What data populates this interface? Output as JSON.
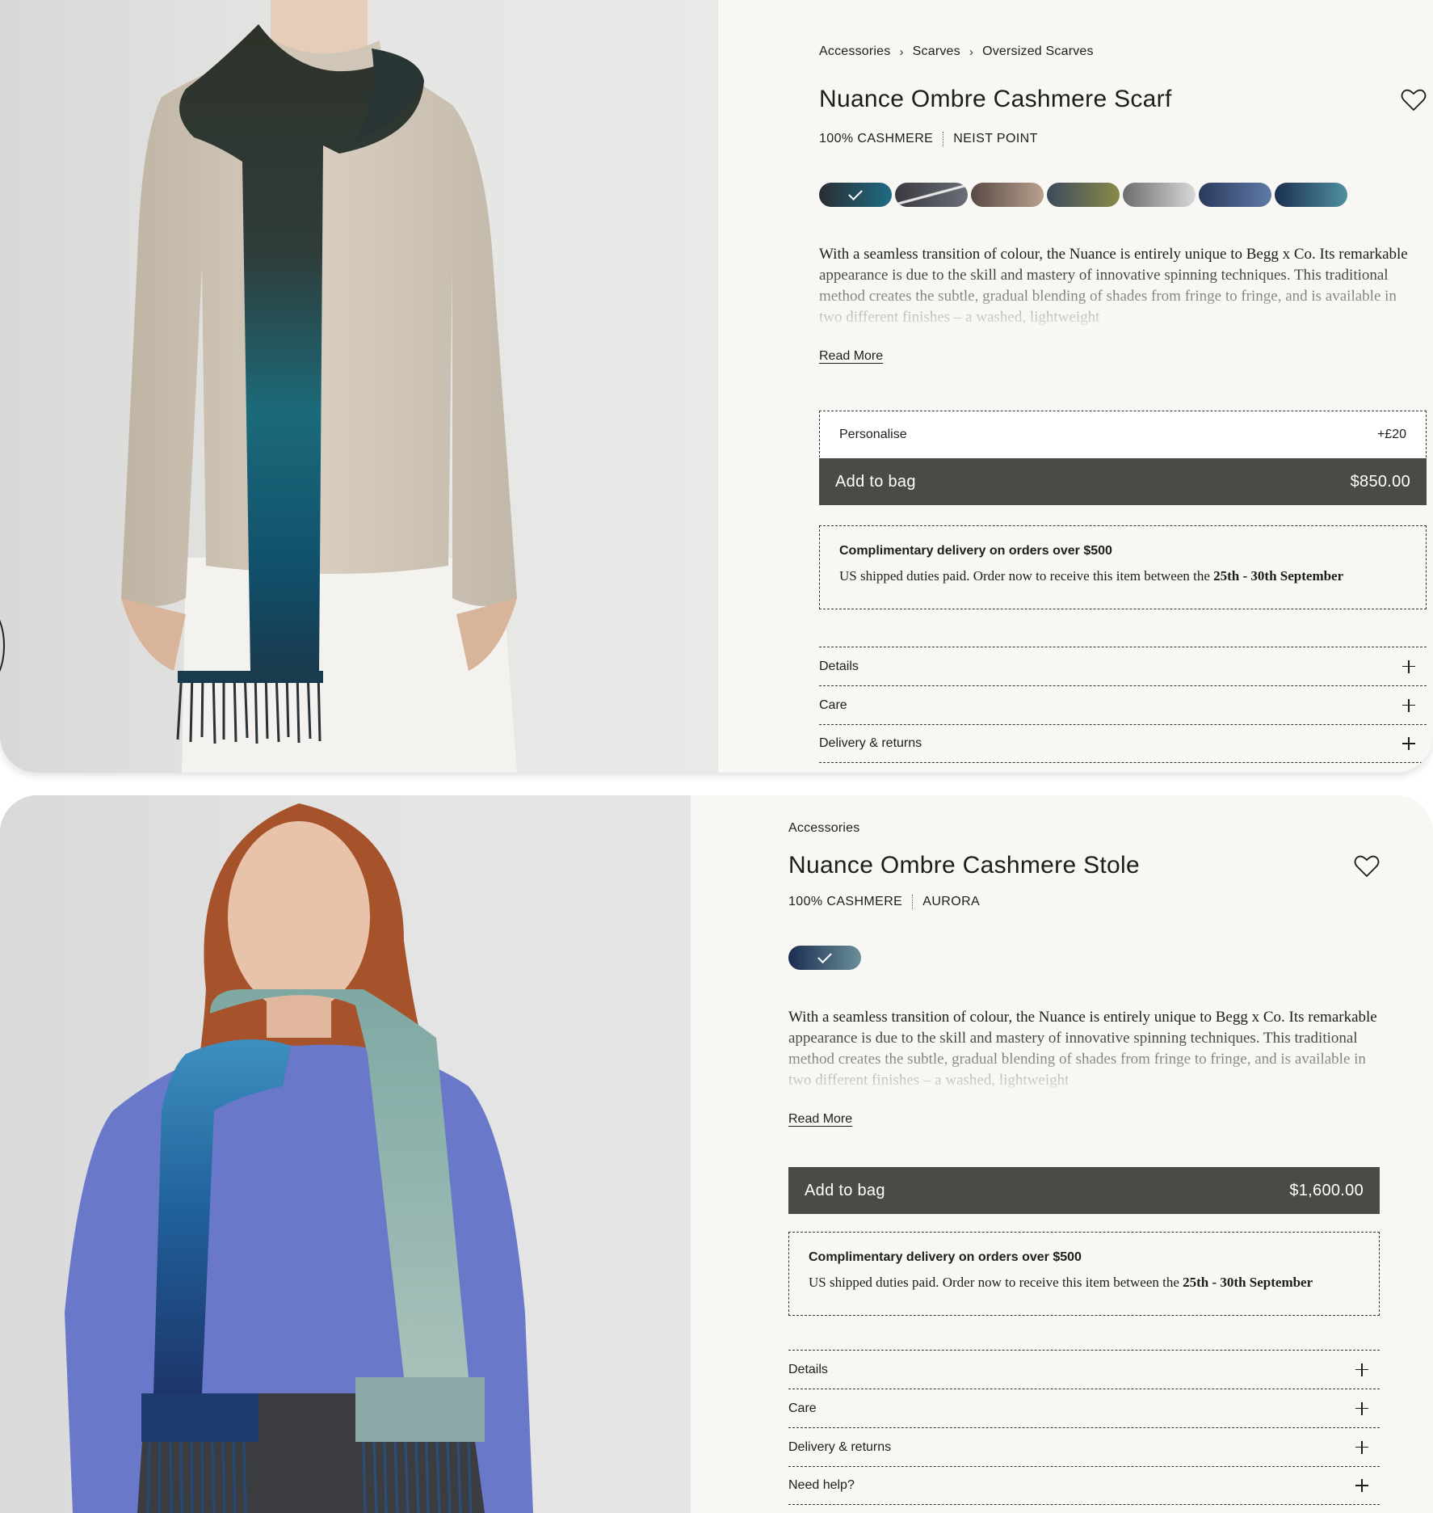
{
  "product1": {
    "breadcrumbs": [
      "Accessories",
      "Scarves",
      "Oversized Scarves"
    ],
    "title": "Nuance Ombre Cashmere Scarf",
    "material": "100% CASHMERE",
    "colorway": "NEIST POINT",
    "description": "With a seamless transition of colour, the Nuance is entirely unique to Begg x Co. Its remarkable appearance is due to the skill and mastery of innovative spinning techniques. This traditional method creates the subtle, gradual blending of shades from fringe to fringe, and is available in two different finishes – a washed, lightweight",
    "read_more": "Read More",
    "personalise_label": "Personalise",
    "personalise_price": "+£20",
    "add_to_bag": "Add to bag",
    "price": "$850.00",
    "delivery_heading": "Complimentary delivery on orders over $500",
    "delivery_text": "US shipped duties paid. Order now to receive this item between the ",
    "delivery_dates": "25th - 30th September",
    "accordion": [
      "Details",
      "Care",
      "Delivery & returns"
    ],
    "swatch_colors": [
      [
        "#2b2d31",
        "#1f6b84"
      ],
      [
        "#3a3b40",
        "#6b6e78"
      ],
      [
        "#5a4a44",
        "#b8a08f"
      ],
      [
        "#3d4a5c",
        "#8a8a4a"
      ],
      [
        "#6d6d6d",
        "#d8d8d8"
      ],
      [
        "#2a3a5c",
        "#5f7aa8"
      ],
      [
        "#1c3050",
        "#4f8fa0"
      ]
    ]
  },
  "product2": {
    "breadcrumbs": [
      "Accessories"
    ],
    "title": "Nuance Ombre Cashmere Stole",
    "material": "100% CASHMERE",
    "colorway": "AURORA",
    "description": "With a seamless transition of colour, the Nuance is entirely unique to Begg x Co. Its remarkable appearance is due to the skill and mastery of innovative spinning techniques. This traditional method creates the subtle, gradual blending of shades from fringe to fringe, and is available in two different finishes – a washed, lightweight",
    "read_more": "Read More",
    "add_to_bag": "Add to bag",
    "price": "$1,600.00",
    "delivery_heading": "Complimentary delivery on orders over $500",
    "delivery_text": "US shipped duties paid. Order now to receive this item between the ",
    "delivery_dates": "25th - 30th September",
    "accordion": [
      "Details",
      "Care",
      "Delivery & returns",
      "Need help?"
    ],
    "swatch_colors": [
      [
        "#1b2d4f",
        "#6a8f9a"
      ]
    ]
  },
  "colors": {
    "page_bg": "#f8f7f3",
    "button_bg": "#4b4a47",
    "text": "#1d1d1b"
  }
}
